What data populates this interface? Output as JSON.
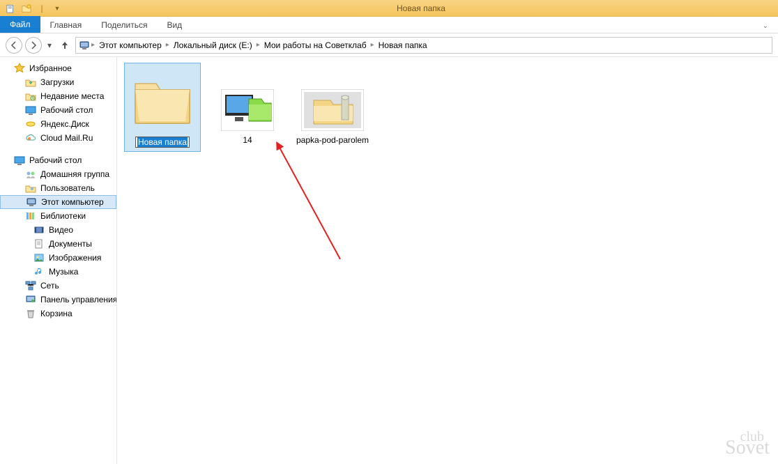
{
  "window": {
    "title": "Новая папка"
  },
  "ribbon": {
    "file": "Файл",
    "tabs": [
      "Главная",
      "Поделиться",
      "Вид"
    ]
  },
  "breadcrumbs": [
    "Этот компьютер",
    "Локальный диск (E:)",
    "Мои работы на Советклаб",
    "Новая папка"
  ],
  "navpane": {
    "favorites": {
      "header": "Избранное",
      "items": [
        "Загрузки",
        "Недавние места",
        "Рабочий стол",
        "Яндекс.Диск",
        "Cloud Mail.Ru"
      ]
    },
    "desktopGroup": {
      "header": "Рабочий стол",
      "items": [
        "Домашняя группа",
        "Пользователь",
        "Этот компьютер",
        "Библиотеки"
      ],
      "libs": [
        "Видео",
        "Документы",
        "Изображения",
        "Музыка"
      ],
      "tail": [
        "Сеть",
        "Панель управления",
        "Корзина"
      ]
    }
  },
  "files": [
    {
      "name": "Новая папка",
      "kind": "folder",
      "editing": true
    },
    {
      "name": "14",
      "kind": "image"
    },
    {
      "name": "papka-pod-parolem",
      "kind": "image-folder"
    }
  ],
  "watermark": {
    "line1": "club",
    "line2": "Sovet"
  }
}
